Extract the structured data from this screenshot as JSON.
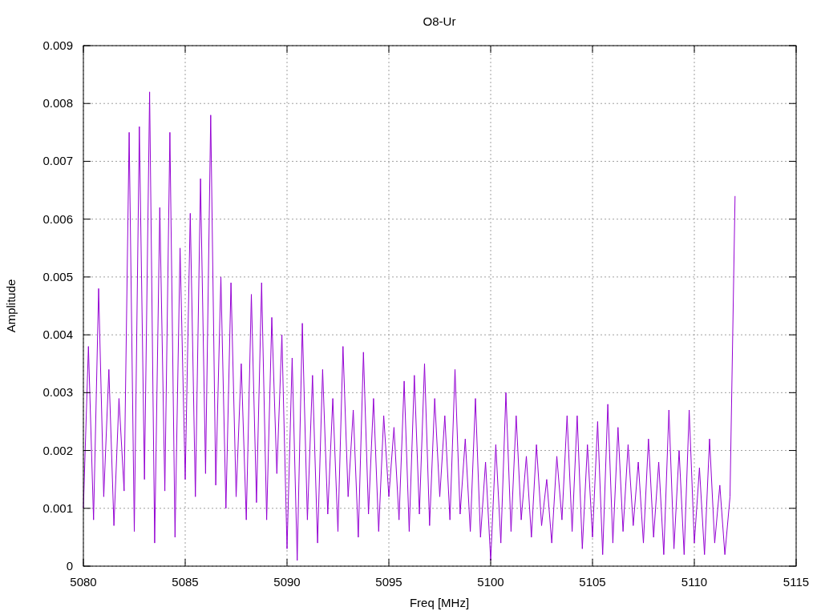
{
  "chart_data": {
    "type": "line",
    "title": "O8-Ur",
    "xlabel": "Freq [MHz]",
    "ylabel": "Amplitude",
    "xlim": [
      5080,
      5115
    ],
    "ylim": [
      0,
      0.009
    ],
    "grid": true,
    "xticks": [
      5080,
      5085,
      5090,
      5095,
      5100,
      5105,
      5110,
      5115
    ],
    "yticks": [
      {
        "value": 0,
        "label": "0"
      },
      {
        "value": 0.001,
        "label": "0.001"
      },
      {
        "value": 0.002,
        "label": "0.002"
      },
      {
        "value": 0.003,
        "label": "0.003"
      },
      {
        "value": 0.004,
        "label": "0.004"
      },
      {
        "value": 0.005,
        "label": "0.005"
      },
      {
        "value": 0.006,
        "label": "0.006"
      },
      {
        "value": 0.007,
        "label": "0.007"
      },
      {
        "value": 0.008,
        "label": "0.008"
      },
      {
        "value": 0.009,
        "label": "0.009"
      }
    ],
    "x": [
      5080,
      5080.25,
      5080.5,
      5080.75,
      5081,
      5081.25,
      5081.5,
      5081.75,
      5082,
      5082.25,
      5082.5,
      5082.75,
      5083,
      5083.25,
      5083.5,
      5083.75,
      5084,
      5084.25,
      5084.5,
      5084.75,
      5085,
      5085.25,
      5085.5,
      5085.75,
      5086,
      5086.25,
      5086.5,
      5086.75,
      5087,
      5087.25,
      5087.5,
      5087.75,
      5088,
      5088.25,
      5088.5,
      5088.75,
      5089,
      5089.25,
      5089.5,
      5089.75,
      5090,
      5090.25,
      5090.5,
      5090.75,
      5091,
      5091.25,
      5091.5,
      5091.75,
      5092,
      5092.25,
      5092.5,
      5092.75,
      5093,
      5093.25,
      5093.5,
      5093.75,
      5094,
      5094.25,
      5094.5,
      5094.75,
      5095,
      5095.25,
      5095.5,
      5095.75,
      5096,
      5096.25,
      5096.5,
      5096.75,
      5097,
      5097.25,
      5097.5,
      5097.75,
      5098,
      5098.25,
      5098.5,
      5098.75,
      5099,
      5099.25,
      5099.5,
      5099.75,
      5100,
      5100.25,
      5100.5,
      5100.75,
      5101,
      5101.25,
      5101.5,
      5101.75,
      5102,
      5102.25,
      5102.5,
      5102.75,
      5103,
      5103.25,
      5103.5,
      5103.75,
      5104,
      5104.25,
      5104.5,
      5104.75,
      5105,
      5105.25,
      5105.5,
      5105.75,
      5106,
      5106.25,
      5106.5,
      5106.75,
      5107,
      5107.25,
      5107.5,
      5107.75,
      5108,
      5108.25,
      5108.5,
      5108.75,
      5109,
      5109.25,
      5109.5,
      5109.75,
      5110,
      5110.25,
      5110.5,
      5110.75,
      5111,
      5111.25,
      5111.5,
      5111.75,
      5112
    ],
    "series": [
      {
        "color": "#9400d3",
        "values": [
          0.001,
          0.0038,
          0.0008,
          0.0048,
          0.0012,
          0.0034,
          0.0007,
          0.0029,
          0.0013,
          0.0075,
          0.0006,
          0.0076,
          0.0015,
          0.0082,
          0.0004,
          0.0062,
          0.0013,
          0.0075,
          0.0005,
          0.0055,
          0.0015,
          0.0061,
          0.0012,
          0.0067,
          0.0016,
          0.0078,
          0.0014,
          0.005,
          0.001,
          0.0049,
          0.0012,
          0.0035,
          0.0008,
          0.0047,
          0.0011,
          0.0049,
          0.0008,
          0.0043,
          0.0016,
          0.004,
          0.0003,
          0.0036,
          0.0001,
          0.0042,
          0.0008,
          0.0033,
          0.0004,
          0.0034,
          0.0009,
          0.0029,
          0.0006,
          0.0038,
          0.0012,
          0.0027,
          0.0005,
          0.0037,
          0.0009,
          0.0029,
          0.0006,
          0.0026,
          0.0012,
          0.0024,
          0.0008,
          0.0032,
          0.0006,
          0.0033,
          0.0009,
          0.0035,
          0.0007,
          0.0029,
          0.0012,
          0.0026,
          0.0008,
          0.0034,
          0.0009,
          0.0022,
          0.0006,
          0.0029,
          0.0005,
          0.0018,
          0.0001,
          0.0021,
          0.0004,
          0.003,
          0.0006,
          0.0026,
          0.0008,
          0.0019,
          0.0005,
          0.0021,
          0.0007,
          0.0015,
          0.0004,
          0.0019,
          0.0008,
          0.0026,
          0.0006,
          0.0026,
          0.0003,
          0.0021,
          0.0005,
          0.0025,
          0.0002,
          0.0028,
          0.0004,
          0.0024,
          0.0006,
          0.0021,
          0.0007,
          0.0018,
          0.0004,
          0.0022,
          0.0005,
          0.0018,
          0.0002,
          0.0027,
          0.0003,
          0.002,
          0.0002,
          0.0027,
          0.0004,
          0.0017,
          0.0002,
          0.0022,
          0.0004,
          0.0014,
          0.0002,
          0.0012,
          0.0064
        ]
      }
    ]
  }
}
